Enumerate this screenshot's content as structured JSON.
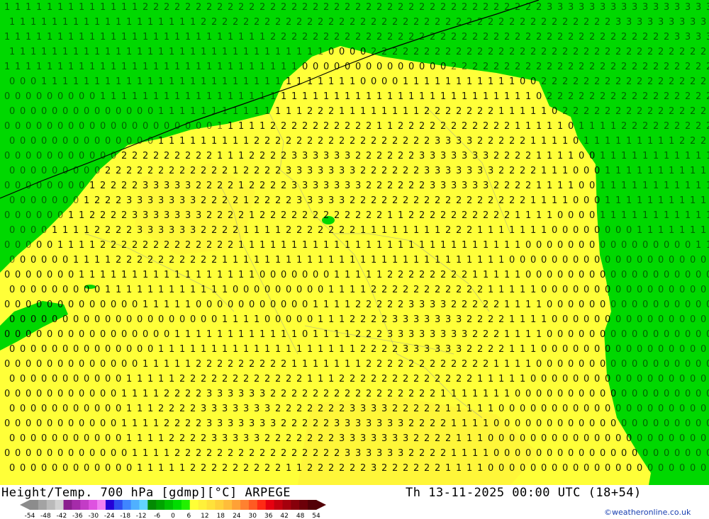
{
  "header": {
    "title": "Height/Temp. 700 hPa [gdmp][°C] ARPEGE",
    "valid_time": "Th 13-11-2025 00:00 UTC (18+54)",
    "credit": "©weatheronline.co.uk"
  },
  "legend": {
    "tick_labels": [
      "-54",
      "-48",
      "-42",
      "-36",
      "-30",
      "-24",
      "-18",
      "-12",
      "-6",
      "0",
      "6",
      "12",
      "18",
      "24",
      "30",
      "36",
      "42",
      "48",
      "54"
    ],
    "colors": [
      "#8c8c8c",
      "#a3a3a3",
      "#bababa",
      "#d2d2d2",
      "#8a1f8e",
      "#a52ba9",
      "#c33cc6",
      "#de52e0",
      "#f07ff2",
      "#2400d6",
      "#2e4cf0",
      "#3f85ff",
      "#50b0ff",
      "#62d4ff",
      "#038a03",
      "#00a300",
      "#00c000",
      "#00dc00",
      "#22f000",
      "#ffff36",
      "#fff13a",
      "#ffe23a",
      "#ffd13a",
      "#ffbd3a",
      "#ffa136",
      "#ff8130",
      "#ff5a22",
      "#ff2a14",
      "#e60010",
      "#c4000e",
      "#a5000d",
      "#87000b",
      "#6c0009",
      "#520007"
    ]
  },
  "map": {
    "colors": {
      "green": "#00d800",
      "yellow": "#ffff38",
      "contour": "#000000",
      "border": "#9a9a9a"
    }
  }
}
